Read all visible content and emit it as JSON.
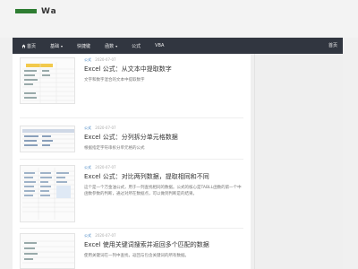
{
  "brand": {
    "name": "Wa",
    "accent": "#2e7d32"
  },
  "nav": {
    "items": [
      {
        "label": "首页",
        "icon": "home-icon"
      },
      {
        "label": "基础",
        "caret": true
      },
      {
        "label": "快捷键"
      },
      {
        "label": "函数",
        "caret": true
      },
      {
        "label": "公式"
      },
      {
        "label": "VBA"
      }
    ],
    "right_label": "首页"
  },
  "articles": [
    {
      "category": "公式",
      "date": "2020-07-07",
      "title": "Excel 公式：从文本中提取数字",
      "excerpt": "文字和数字混合的文本中提取数字"
    },
    {
      "category": "公式",
      "date": "2020-07-07",
      "title": "Excel 公式：分列拆分单元格数据",
      "excerpt": "根据指定字符串拆分单元格的公式"
    },
    {
      "category": "公式",
      "date": "2020-07-07",
      "title": "Excel 公式：对比两列数据，提取相同和不同",
      "excerpt": "这个是一个万金油公式，用于一列查找相同的数据。公式的核心是TABLL函数的第一个中函数参数的判断，通过对所在数据点，可以做到判断是的结果。"
    },
    {
      "category": "公式",
      "date": "2020-07-07",
      "title": "Excel 使用关键词搜索并返回多个匹配的数据",
      "excerpt": "使用关键词在一列中查找，返回与包含关键词的所有数据。"
    }
  ]
}
